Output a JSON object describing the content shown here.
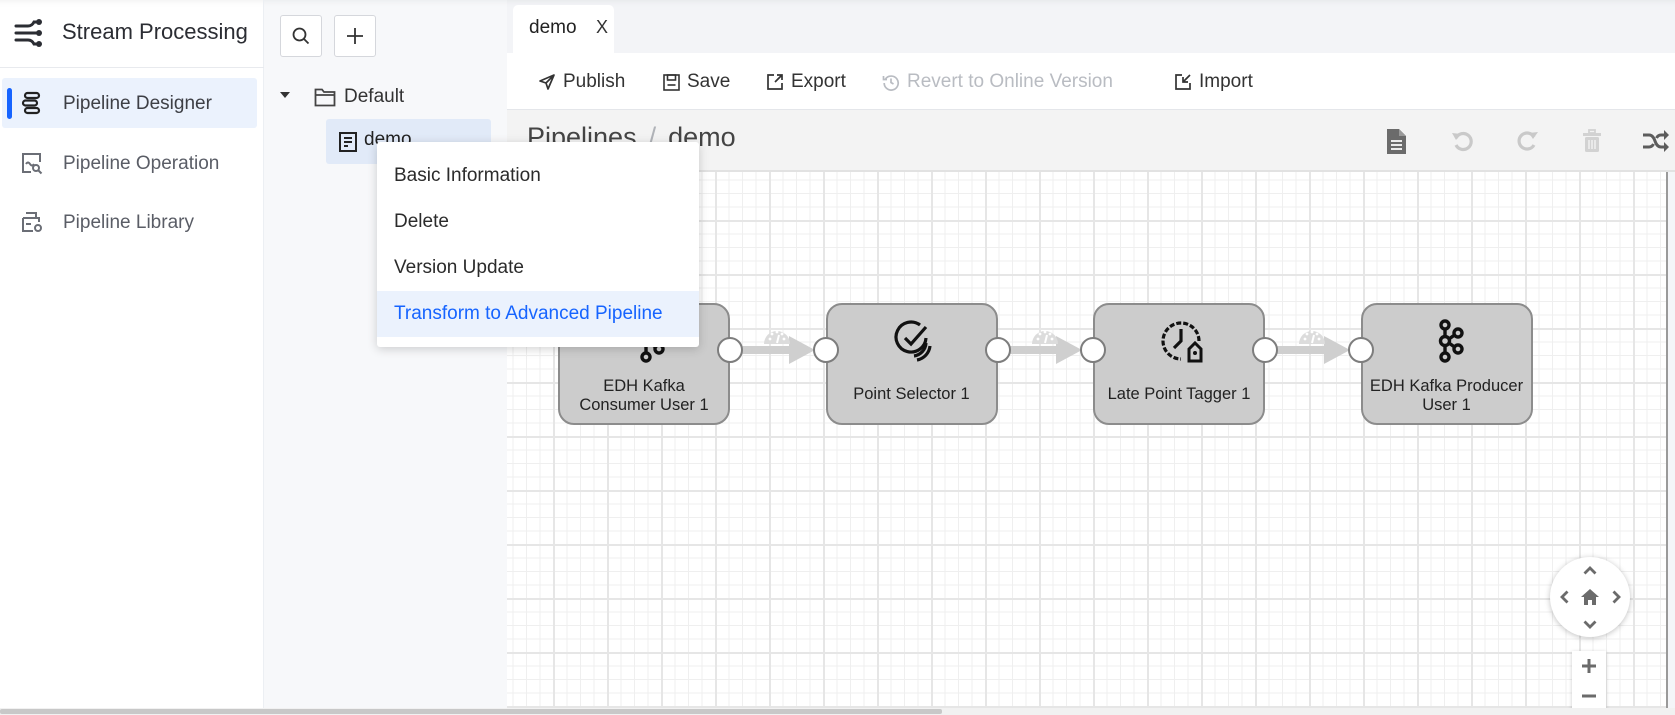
{
  "app": {
    "title": "Stream Processing",
    "logo_icon": "stream-flow-icon"
  },
  "nav": {
    "items": [
      {
        "label": "Pipeline Designer",
        "icon": "pipeline-designer-icon",
        "active": true
      },
      {
        "label": "Pipeline Operation",
        "icon": "pipeline-operation-icon",
        "active": false
      },
      {
        "label": "Pipeline Library",
        "icon": "pipeline-library-icon",
        "active": false
      }
    ]
  },
  "tree": {
    "search_icon": "search-icon",
    "add_icon": "plus-icon",
    "folder": {
      "label": "Default",
      "expanded": true,
      "icon": "folder-icon"
    },
    "pipelines": [
      {
        "label": "demo",
        "icon": "document-icon",
        "selected": true
      }
    ]
  },
  "tabs": [
    {
      "label": "demo",
      "close": "X",
      "active": true
    }
  ],
  "toolbar": {
    "publish": "Publish",
    "save": "Save",
    "export": "Export",
    "revert": "Revert to Online Version",
    "revert_disabled": true,
    "import": "Import"
  },
  "breadcrumb": {
    "root": "Pipelines",
    "separator": "/",
    "current": "demo"
  },
  "canvas_tools": [
    {
      "name": "document-icon",
      "enabled": true
    },
    {
      "name": "undo-icon",
      "enabled": false
    },
    {
      "name": "redo-icon",
      "enabled": false
    },
    {
      "name": "trash-icon",
      "enabled": false
    },
    {
      "name": "shuffle-icon",
      "enabled": true
    }
  ],
  "pipeline": {
    "nodes": [
      {
        "label": "EDH Kafka Consumer User 1",
        "icon": "kafka-consumer-icon"
      },
      {
        "label": "Point Selector 1",
        "icon": "point-selector-icon"
      },
      {
        "label": "Late Point Tagger 1",
        "icon": "late-point-tagger-icon"
      },
      {
        "label": "EDH Kafka Producer User 1",
        "icon": "kafka-producer-icon"
      }
    ],
    "edges": [
      {
        "from": 0,
        "to": 1
      },
      {
        "from": 1,
        "to": 2
      },
      {
        "from": 2,
        "to": 3
      }
    ]
  },
  "navigation": {
    "up": "chevron-up-icon",
    "down": "chevron-down-icon",
    "left": "chevron-left-icon",
    "right": "chevron-right-icon",
    "home": "home-icon",
    "zoom_in": "+",
    "zoom_out": "−"
  },
  "context_menu": {
    "items": [
      {
        "label": "Basic Information",
        "highlighted": false
      },
      {
        "label": "Delete",
        "highlighted": false
      },
      {
        "label": "Version Update",
        "highlighted": false
      },
      {
        "label": "Transform to Advanced Pipeline",
        "highlighted": true
      }
    ]
  },
  "colors": {
    "accent": "#1664ff",
    "active_bg": "#ebf2fd",
    "node_fill": "#cccccc",
    "node_border": "#8c8c8c"
  }
}
